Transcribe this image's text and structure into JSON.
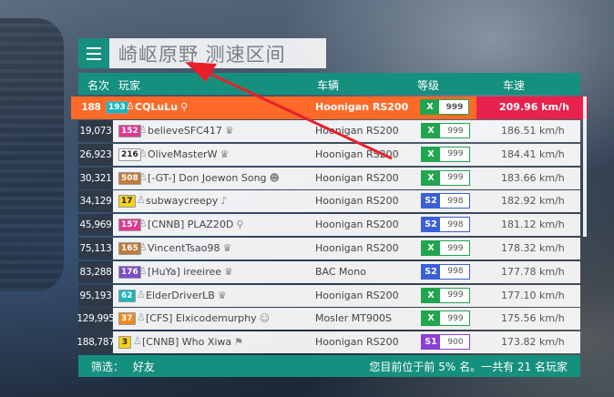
{
  "header": {
    "title": "崎岖原野 测速区间"
  },
  "columns": {
    "rank": "名次",
    "player": "玩家",
    "car": "车辆",
    "class": "等级",
    "speed": "车速"
  },
  "rows": [
    {
      "rank": "188",
      "level": "193",
      "level_color": "#19b6b9",
      "player": "CQLuLu",
      "badge": "search-icon",
      "car": "Hoonigan RS200",
      "class": "X",
      "class_color": "#21a54f",
      "pi": "999",
      "speed": "209.96 km/h",
      "self": true
    },
    {
      "rank": "19,073",
      "level": "152",
      "level_color": "#e0388f",
      "player": "believeSFC417",
      "badge": "crown-icon",
      "car": "Hoonigan RS200",
      "class": "X",
      "class_color": "#21a54f",
      "pi": "999",
      "speed": "186.51 km/h"
    },
    {
      "rank": "26,923",
      "level": "216",
      "level_color": "#ffffff",
      "player": "OliveMasterW",
      "badge": "crown-icon",
      "car": "Hoonigan RS200",
      "class": "X",
      "class_color": "#21a54f",
      "pi": "999",
      "speed": "184.41 km/h"
    },
    {
      "rank": "30,321",
      "level": "508",
      "level_color": "#c07a3a",
      "player": "[-GT-] Don Joewon Song",
      "badge": "mask-icon",
      "car": "Hoonigan RS200",
      "class": "X",
      "class_color": "#21a54f",
      "pi": "999",
      "speed": "183.66 km/h"
    },
    {
      "rank": "34,129",
      "level": "17",
      "level_color": "#f5d21a",
      "player": "subwaycreepy",
      "badge": "horn-icon",
      "car": "Hoonigan RS200",
      "class": "S2",
      "class_color": "#3a5fd6",
      "pi": "998",
      "speed": "182.92 km/h"
    },
    {
      "rank": "45,969",
      "level": "157",
      "level_color": "#e0388f",
      "player": "[CNNB] PLAZ20D",
      "badge": "search-icon",
      "car": "Hoonigan RS200",
      "class": "S2",
      "class_color": "#3a5fd6",
      "pi": "998",
      "speed": "181.12 km/h"
    },
    {
      "rank": "75,113",
      "level": "165",
      "level_color": "#c07a3a",
      "player": "VincentTsao98",
      "badge": "crown-icon",
      "car": "Hoonigan RS200",
      "class": "X",
      "class_color": "#21a54f",
      "pi": "999",
      "speed": "178.32 km/h"
    },
    {
      "rank": "83,288",
      "level": "176",
      "level_color": "#7a4cc8",
      "player": "[HuYa] ireeiree",
      "badge": "crown-icon",
      "car": "BAC Mono",
      "class": "S2",
      "class_color": "#3a5fd6",
      "pi": "998",
      "speed": "177.78 km/h"
    },
    {
      "rank": "95,193",
      "level": "62",
      "level_color": "#19b6b9",
      "player": "ElderDriverLB",
      "badge": "crown-icon",
      "car": "Hoonigan RS200",
      "class": "X",
      "class_color": "#21a54f",
      "pi": "999",
      "speed": "177.10 km/h"
    },
    {
      "rank": "129,995",
      "level": "37",
      "level_color": "#f08a1c",
      "player": "[CFS] Elxicodemurphy",
      "badge": "face-icon",
      "car": "Mosler MT900S",
      "class": "X",
      "class_color": "#21a54f",
      "pi": "999",
      "speed": "175.56 km/h"
    },
    {
      "rank": "188,787",
      "level": "3",
      "level_color": "#f5d21a",
      "player": "[CNNB] Who Xiwa",
      "badge": "flag-icon",
      "car": "Hoonigan RS200",
      "class": "S1",
      "class_color": "#8b3fd6",
      "pi": "900",
      "speed": "173.82 km/h"
    }
  ],
  "footer": {
    "filter_label": "筛选：",
    "filter_value": "好友",
    "status": "您目前位于前 5% 名。一共有 21 名玩家"
  },
  "colors": {
    "accent": "#16907e",
    "highlight": "#ff6a28",
    "speed_highlight": "#e8224e",
    "annotation": "#e8202a"
  }
}
